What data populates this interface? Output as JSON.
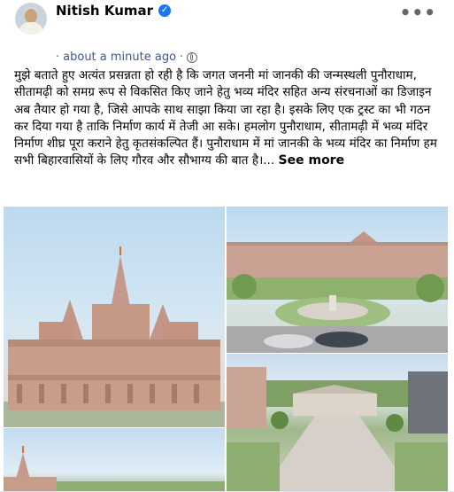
{
  "post": {
    "author": "Nitish Kumar",
    "time": "about a minute ago",
    "separator": "·",
    "more_glyph": "•••",
    "verified_glyph": "✓",
    "text": "मुझे बताते हुए अत्यंत प्रसन्नता हो रही है कि जगत जननी मां जानकी की जन्मस्थली पुनौराधाम, सीतामढ़ी को समग्र रूप से विकसित किए जाने हेतु भव्य मंदिर सहित अन्य संरचनाओं का डिजाइन अब तैयार हो गया है, जिसे आपके साथ साझा किया जा रहा है। इसके लिए एक ट्रस्ट का भी गठन कर दिया गया है ताकि निर्माण कार्य में तेजी आ सके। हमलोग पुनौराधाम, सीतामढ़ी में भव्य मंदिर निर्माण शीघ्र पूरा कराने हेतु कृतसंकल्पित हैं। पुनौराधाम में मां जानकी के भव्य मंदिर का निर्माण हम सभी बिहारवासियों के लिए गौरव और सौभाग्य की बात है।...",
    "see_more": "See more",
    "privacy_icon": "globe-icon"
  },
  "colors": {
    "verified": "#1877f2",
    "meta": "#65676b",
    "time_link": "#3b5998"
  }
}
